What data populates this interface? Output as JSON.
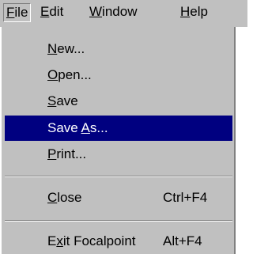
{
  "menubar": {
    "items": [
      {
        "pre": "",
        "key": "F",
        "post": "ile"
      },
      {
        "pre": "",
        "key": "E",
        "post": "dit"
      },
      {
        "pre": "",
        "key": "W",
        "post": "indow"
      },
      {
        "pre": "",
        "key": "H",
        "post": "elp"
      }
    ]
  },
  "file_menu": {
    "items": [
      {
        "pre": "",
        "key": "N",
        "post": "ew...",
        "shortcut": ""
      },
      {
        "pre": "",
        "key": "O",
        "post": "pen...",
        "shortcut": ""
      },
      {
        "pre": "",
        "key": "S",
        "post": "ave",
        "shortcut": ""
      },
      {
        "pre": "Save ",
        "key": "A",
        "post": "s...",
        "shortcut": ""
      },
      {
        "pre": "",
        "key": "P",
        "post": "rint...",
        "shortcut": ""
      },
      {
        "pre": "",
        "key": "C",
        "post": "lose",
        "shortcut": "Ctrl+F4"
      },
      {
        "pre": "E",
        "key": "x",
        "post": "it Focalpoint",
        "shortcut": "Alt+F4"
      }
    ],
    "highlighted_index": 3
  },
  "colors": {
    "face": "#c0c0c0",
    "highlight": "#000080",
    "highlight_text": "#ffffff"
  }
}
